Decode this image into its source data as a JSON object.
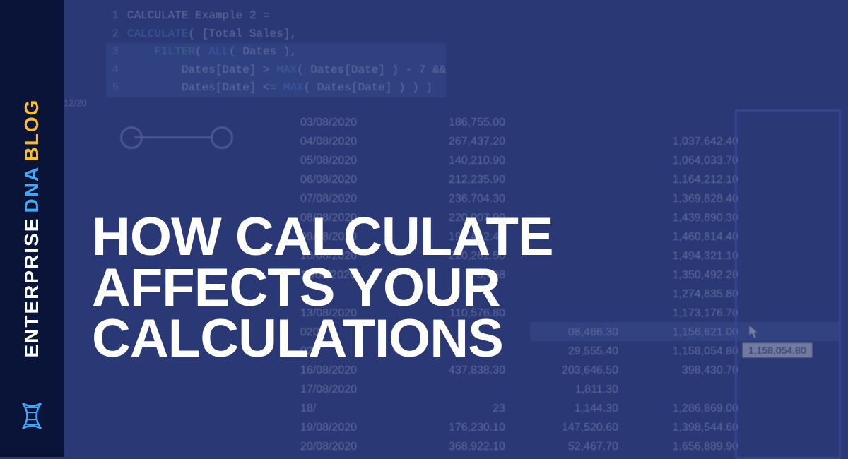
{
  "sidebar": {
    "enterprise": "ENTERPRISE",
    "dna": "DNA",
    "blog": "BLOG"
  },
  "headline": {
    "line1": "HOW CALCULATE",
    "line2": "AFFECTS YOUR",
    "line3": "CALCULATIONS"
  },
  "code": {
    "line1": "CALCULATE Example 2 =",
    "line2a": "CALCULATE",
    "line2b": "( [Total Sales],",
    "line3a": "FILTER",
    "line3b": "( ",
    "line3c": "ALL",
    "line3d": "( Dates ),",
    "line4a": "Dates[Date] > ",
    "line4b": "MAX",
    "line4c": "( Dates[Date] ) - 7 &&",
    "line5a": "Dates[Date] <= ",
    "line5b": "MAX",
    "line5c": "( Dates[Date] ) ) )"
  },
  "date_label": "12/20",
  "tooltip": "1,158,054.80",
  "table": {
    "rows": [
      {
        "date": "03/08/2020",
        "v1": "186,755.00",
        "v2": "",
        "v3": ""
      },
      {
        "date": "04/08/2020",
        "v1": "267,437.20",
        "v2": "",
        "v3": "1,037,642.40"
      },
      {
        "date": "05/08/2020",
        "v1": "140,210.90",
        "v2": "",
        "v3": "1,064,033.70"
      },
      {
        "date": "06/08/2020",
        "v1": "212,235.90",
        "v2": "",
        "v3": "1,164,212.10"
      },
      {
        "date": "07/08/2020",
        "v1": "236,704.30",
        "v2": "",
        "v3": "1,369,828.40"
      },
      {
        "date": "08/08/2020",
        "v1": "220,007.90",
        "v2": "",
        "v3": "1,439,890.30"
      },
      {
        "date": "09/08/2020",
        "v1": "197,462.40",
        "v2": "",
        "v3": "1,460,814.40"
      },
      {
        "date": "10/08/2020",
        "v1": "220,262.50",
        "v2": "",
        "v3": "1,494,321.10"
      },
      {
        "date": "11/08/2020",
        "v1": "3,608",
        "v2": "",
        "v3": "1,350,492.20"
      },
      {
        "date": "",
        "v1": "",
        "v2": "",
        "v3": "1,274,835.80"
      },
      {
        "date": "13/08/2020",
        "v1": "110,576.80",
        "v2": "",
        "v3": "1,173,176.70"
      },
      {
        "date": "020",
        "v1": "",
        "v2": "08,466.30",
        "v3": "1,156,621.00"
      },
      {
        "date": "020",
        "v1": "",
        "v2": "29,555.40",
        "v3": "1,158,054.80"
      },
      {
        "date": "16/08/2020",
        "v1": "437,838.30",
        "v2": "203,646.50",
        "v3": "398,430.70"
      },
      {
        "date": "17/08/2020",
        "v1": "",
        "v2": "1,811.30",
        "v3": ""
      },
      {
        "date": "18/",
        "v1": "23",
        "v2": "1,144.30",
        "v3": "1,286,869.00"
      },
      {
        "date": "19/08/2020",
        "v1": "176,230.10",
        "v2": "147,520.60",
        "v3": "1,398,544.60"
      },
      {
        "date": "20/08/2020",
        "v1": "368,922.10",
        "v2": "52,467.70",
        "v3": "1,656,889.90"
      }
    ]
  }
}
